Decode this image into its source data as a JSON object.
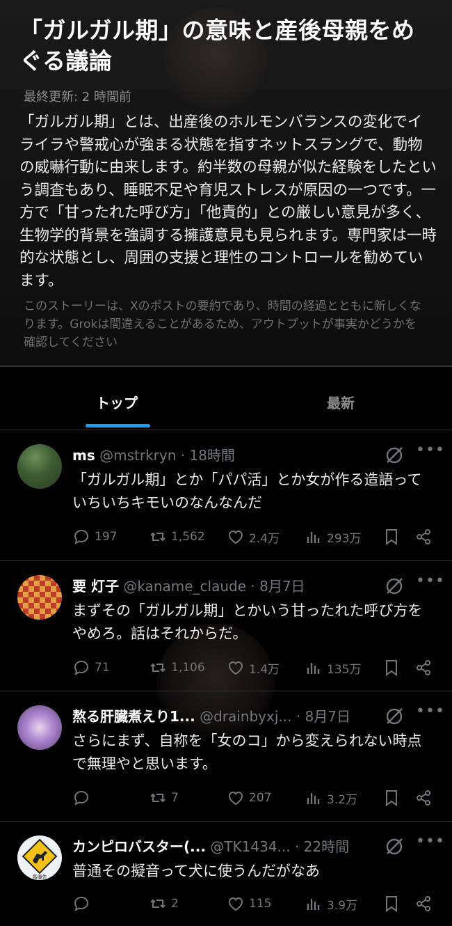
{
  "story": {
    "title": "「ガルガル期」の意味と産後母親をめぐる議論",
    "updated": "最終更新: 2 時間前",
    "summary": "「ガルガル期」とは、出産後のホルモンバランスの変化でイライラや警戒心が強まる状態を指すネットスラングで、動物の威嚇行動に由来します。約半数の母親が似た経験をしたという調査もあり、睡眠不足や育児ストレスが原因の一つです。一方で「甘ったれた呼び方」「他責的」との厳しい意見が多く、生物学的背景を強調する擁護意見も見られます。専門家は一時的な状態とし、周囲の支援と理性のコントロールを勧めています。",
    "disclaimer": "このストーリーは、Xのポストの要約であり、時間の経過とともに新しくなります。Grokは間違えることがあるため、アウトプットが事実かどうかを確認してください"
  },
  "tabs": [
    {
      "label": "トップ",
      "active": true
    },
    {
      "label": "最新",
      "active": false
    }
  ],
  "posts": [
    {
      "name": "ms",
      "handle": "@mstrkryn",
      "time": "· 18時間",
      "text": "「ガルガル期」とか「パパ活」とか女が作る造語っていちいちキモいのなんなんだ",
      "replies": "197",
      "reposts": "1,562",
      "likes": "2.4万",
      "views": "293万"
    },
    {
      "name": "要 灯子",
      "handle": "@kaname_claude",
      "time": "· 8月7日",
      "text": "まずその「ガルガル期」とかいう甘ったれた呼び方をやめろ。話はそれからだ。",
      "replies": "71",
      "reposts": "1,106",
      "likes": "1.4万",
      "views": "135万"
    },
    {
      "name": "熬る肝臓煮えり1...",
      "handle": "@drainbyxj...",
      "time": "· 8月7日",
      "text": "さらにまず、自称を「女のコ」から変えられない時点で無理やと思います。",
      "replies": "",
      "reposts": "7",
      "likes": "207",
      "views": "3.2万"
    },
    {
      "name": "カンピロバスター(...",
      "handle": "@TK1434...",
      "time": "· 22時間",
      "text": "普通その擬音って犬に使うんだがなあ",
      "replies": "",
      "reposts": "2",
      "likes": "115",
      "views": "3.9万",
      "avatar_text": "馬優先"
    }
  ],
  "colors": {
    "accent": "#1d9bf0",
    "muted": "#71767b",
    "bg": "#000000"
  }
}
